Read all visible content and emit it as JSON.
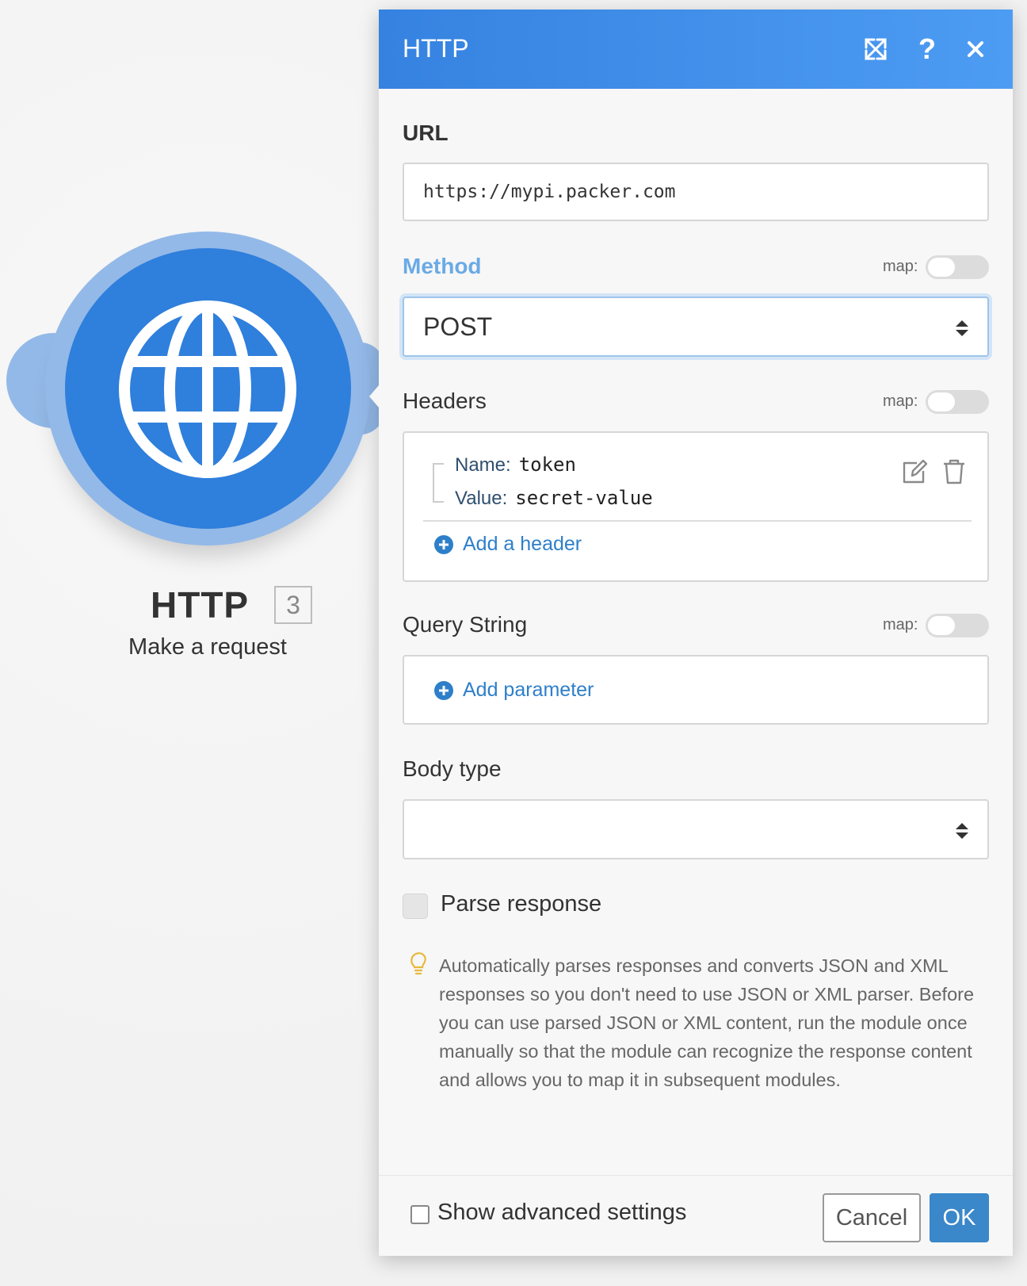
{
  "module": {
    "title": "HTTP",
    "badge": "3",
    "subtitle": "Make a request",
    "icon": "globe-icon",
    "color": "#2f7fdc",
    "ring_color": "#93b9e8"
  },
  "panel": {
    "title": "HTTP",
    "header_icons": [
      "expand-icon",
      "help-icon",
      "close-icon"
    ],
    "help_glyph": "?",
    "header_color": "#3582e0"
  },
  "fields": {
    "url": {
      "label": "URL",
      "value": "https://mypi.packer.com"
    },
    "method": {
      "label": "Method",
      "value": "POST",
      "map_label": "map:"
    },
    "headers": {
      "label": "Headers",
      "map_label": "map:",
      "items": [
        {
          "name_key": "Name:",
          "name": "token",
          "value_key": "Value:",
          "value": "secret-value"
        }
      ],
      "add_label": "Add a header"
    },
    "query_string": {
      "label": "Query String",
      "map_label": "map:",
      "add_label": "Add parameter"
    },
    "body_type": {
      "label": "Body type",
      "value": ""
    },
    "parse_response": {
      "label": "Parse response",
      "hint": "Automatically parses responses and converts JSON and XML responses so you don't need to use JSON or XML parser. Before you can use parsed JSON or XML content, run the module once manually so that the module can recognize the response content and allows you to map it in subsequent modules."
    }
  },
  "footer": {
    "advanced_label": "Show advanced settings",
    "cancel_label": "Cancel",
    "ok_label": "OK",
    "ok_color": "#3a87c9"
  }
}
